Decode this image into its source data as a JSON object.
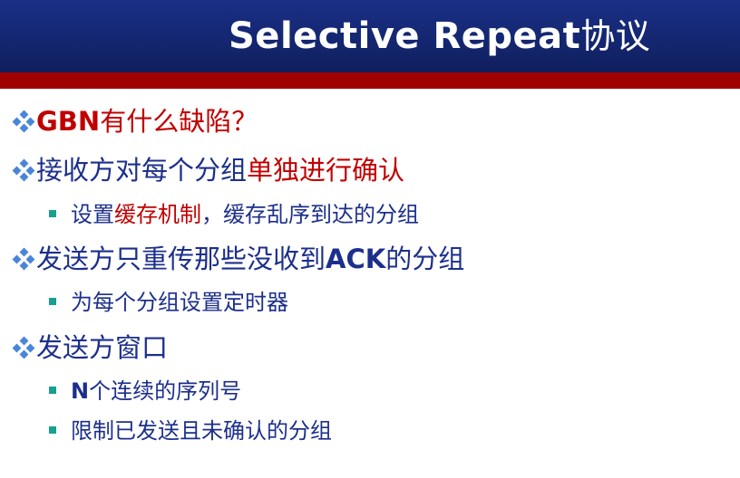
{
  "title": {
    "en": "Selective Repeat",
    "cn": "协议"
  },
  "bullets": [
    {
      "parts": [
        {
          "text": "GBN",
          "style": "red-bold"
        },
        {
          "text": "有什么缺陷？",
          "style": "red"
        }
      ]
    },
    {
      "parts": [
        {
          "text": "接收方对每个分组",
          "style": "normal"
        },
        {
          "text": "单独进行确认",
          "style": "red"
        }
      ]
    },
    {
      "parts": [
        {
          "text": "设置",
          "style": "normal"
        },
        {
          "text": "缓存机制",
          "style": "red"
        },
        {
          "text": "，缓存乱序到达的分组",
          "style": "normal"
        }
      ]
    },
    {
      "parts": [
        {
          "text": "发送方只重传那些没收到",
          "style": "normal"
        },
        {
          "text": "ACK",
          "style": "bold"
        },
        {
          "text": "的分组",
          "style": "normal"
        }
      ]
    },
    {
      "parts": [
        {
          "text": "为每个分组设置定时器",
          "style": "normal"
        }
      ]
    },
    {
      "parts": [
        {
          "text": "发送方窗口",
          "style": "normal"
        }
      ]
    },
    {
      "parts": [
        {
          "text": "N",
          "style": "bold"
        },
        {
          "text": "个连续的序列号",
          "style": "normal"
        }
      ]
    },
    {
      "parts": [
        {
          "text": "限制已发送且未确认的分组",
          "style": "normal"
        }
      ]
    }
  ],
  "colors": {
    "header_blue": "#14266f",
    "accent_red": "#a00000",
    "text_blue": "#1c2f8c",
    "highlight_red": "#c00000",
    "bullet_diamond": "#4a86d8",
    "bullet_square": "#16a090"
  },
  "icons": {
    "level1_bullet": "diamond-bullet-icon",
    "level2_bullet": "square-bullet-icon"
  }
}
